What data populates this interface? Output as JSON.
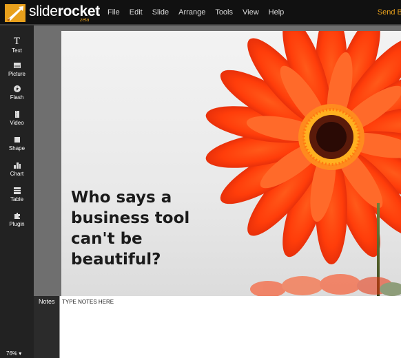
{
  "app": {
    "name_light": "slide",
    "name_bold": "rocket",
    "edition": "zeta",
    "brand_color": "#e8a01c"
  },
  "menu": {
    "items": [
      "File",
      "Edit",
      "Slide",
      "Arrange",
      "Tools",
      "View",
      "Help"
    ],
    "send_link": "Send Bu"
  },
  "tools": [
    {
      "label": "Text",
      "icon": "text-T-icon"
    },
    {
      "label": "Picture",
      "icon": "picture-icon"
    },
    {
      "label": "Flash",
      "icon": "flash-icon"
    },
    {
      "label": "Video",
      "icon": "video-icon"
    },
    {
      "label": "Shape",
      "icon": "shape-icon"
    },
    {
      "label": "Chart",
      "icon": "chart-icon"
    },
    {
      "label": "Table",
      "icon": "table-icon"
    },
    {
      "label": "Plugin",
      "icon": "plugin-icon"
    }
  ],
  "tool_glyphs": {
    "text": "T"
  },
  "zoom": "76% ▾",
  "slide": {
    "title": "Who says a\nbusiness tool\ncan't be\nbeautiful?"
  },
  "notes": {
    "label": "Notes",
    "placeholder": "TYPE NOTES HERE"
  }
}
